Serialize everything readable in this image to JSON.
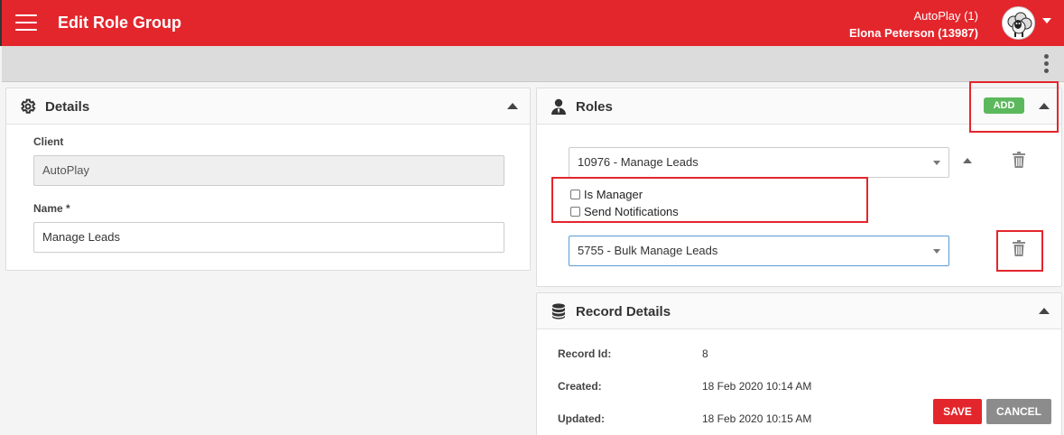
{
  "header": {
    "title": "Edit Role Group",
    "account": "AutoPlay (1)",
    "user": "Elona Peterson (13987)"
  },
  "details": {
    "title": "Details",
    "client_label": "Client",
    "client_value": "AutoPlay",
    "name_label": "Name *",
    "name_value": "Manage Leads"
  },
  "roles": {
    "title": "Roles",
    "add_label": "ADD",
    "items": [
      {
        "value": "10976 - Manage Leads"
      },
      {
        "value": "5755 - Bulk Manage Leads"
      }
    ],
    "options": {
      "is_manager": "Is Manager",
      "send_notifications": "Send Notifications"
    }
  },
  "record_details": {
    "title": "Record Details",
    "record_id_label": "Record Id:",
    "record_id_value": "8",
    "created_label": "Created:",
    "created_value": "18 Feb 2020 10:14 AM",
    "updated_label": "Updated:",
    "updated_value": "18 Feb 2020 10:15 AM"
  },
  "actions": {
    "save_label": "SAVE",
    "cancel_label": "CANCEL"
  },
  "colors": {
    "brand_red": "#e3262c",
    "add_green": "#5cb85c",
    "cancel_gray": "#8c8c8c"
  }
}
